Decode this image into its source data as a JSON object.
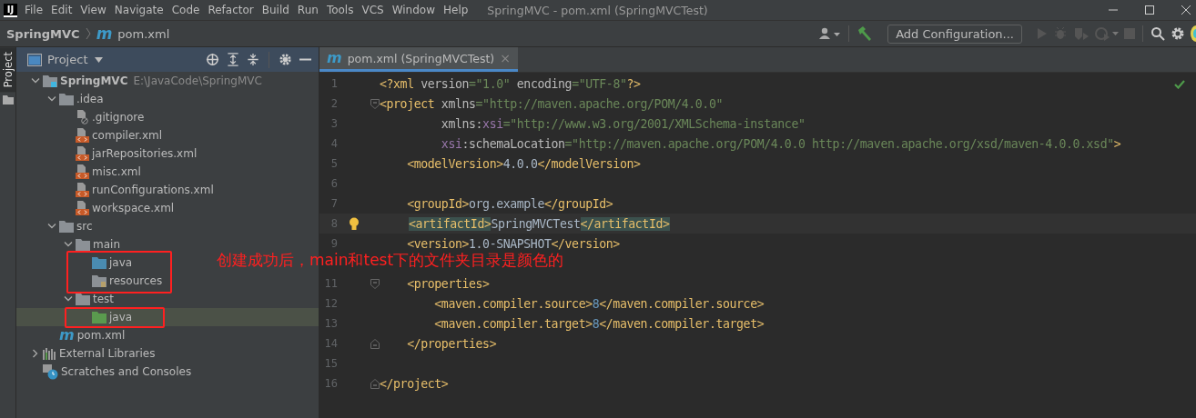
{
  "title_bar": {
    "logo": "IJ",
    "menu": [
      "File",
      "Edit",
      "View",
      "Navigate",
      "Code",
      "Refactor",
      "Build",
      "Run",
      "Tools",
      "VCS",
      "Window",
      "Help"
    ],
    "title": "SpringMVC - pom.xml (SpringMVCTest)"
  },
  "nav_bar": {
    "breadcrumbs": [
      {
        "label": "SpringMVC"
      },
      {
        "icon": "m",
        "label": "pom.xml"
      }
    ],
    "run_config": "Add Configuration..."
  },
  "tool_strip": {
    "tab": {
      "label": "Project",
      "selected": true
    }
  },
  "project_panel": {
    "title": "Project",
    "tree": [
      {
        "label": "SpringMVC",
        "path": "E:\\JavaCode\\SpringMVC",
        "kind": "module",
        "expanded": true,
        "selected": false,
        "children": [
          {
            "label": ".idea",
            "kind": "folder",
            "expanded": true,
            "selected": false,
            "children": [
              {
                "label": ".gitignore",
                "kind": "ignore",
                "selected": false
              },
              {
                "label": "compiler.xml",
                "kind": "xml",
                "selected": false
              },
              {
                "label": "jarRepositories.xml",
                "kind": "xml",
                "selected": false
              },
              {
                "label": "misc.xml",
                "kind": "xml",
                "selected": false
              },
              {
                "label": "runConfigurations.xml",
                "kind": "xml",
                "selected": false
              },
              {
                "label": "workspace.xml",
                "kind": "xml",
                "selected": false
              }
            ]
          },
          {
            "label": "src",
            "kind": "folder",
            "expanded": true,
            "selected": false,
            "children": [
              {
                "label": "main",
                "kind": "folder",
                "expanded": true,
                "selected": false,
                "children": [
                  {
                    "label": "java",
                    "kind": "source",
                    "selected": false
                  },
                  {
                    "label": "resources",
                    "kind": "resources",
                    "selected": false
                  }
                ]
              },
              {
                "label": "test",
                "kind": "folder",
                "expanded": true,
                "selected": false,
                "children": [
                  {
                    "label": "java",
                    "kind": "test",
                    "selected": true
                  }
                ]
              }
            ]
          },
          {
            "label": "pom.xml",
            "kind": "maven",
            "icon": "m",
            "selected": false
          }
        ]
      },
      {
        "label": "External Libraries",
        "kind": "libraries",
        "expanded": false,
        "selected": false
      },
      {
        "label": "Scratches and Consoles",
        "kind": "scratches",
        "selected": false
      }
    ]
  },
  "editor": {
    "tab": {
      "icon": "m",
      "label": "pom.xml (SpringMVCTest)",
      "close": "×",
      "selected": true
    },
    "lines": [
      {
        "number": "1",
        "current": false,
        "tokens": [
          {
            "kind": "tag",
            "s": "<?xml "
          },
          {
            "kind": "attr",
            "s": "version"
          },
          {
            "kind": "str",
            "s": "=\"1.0\" "
          },
          {
            "kind": "attr",
            "s": "encoding"
          },
          {
            "kind": "str",
            "s": "=\"UTF-8\""
          },
          {
            "kind": "tag",
            "s": "?>"
          }
        ]
      },
      {
        "number": "2",
        "current": false,
        "fold": {
          "kind": "start"
        },
        "tokens": [
          {
            "kind": "tag",
            "s": "<project "
          },
          {
            "kind": "attr",
            "s": "xmlns"
          },
          {
            "kind": "str",
            "s": "=\"http://maven.apache.org/POM/4.0.0\""
          }
        ]
      },
      {
        "number": "3",
        "current": false,
        "tokens": [
          {
            "kind": "attr",
            "s": "         xmlns:"
          },
          {
            "kind": "ns",
            "s": "xsi"
          },
          {
            "kind": "str",
            "s": "=\"http://www.w3.org/2001/XMLSchema-instance\""
          }
        ]
      },
      {
        "number": "4",
        "current": false,
        "tokens": [
          {
            "kind": "ns",
            "s": "         xsi"
          },
          {
            "kind": "attr",
            "s": ":schemaLocation"
          },
          {
            "kind": "str",
            "s": "=\"http://maven.apache.org/POM/4.0.0 http://maven.apache.org/xsd/maven-4.0.0.xsd\""
          },
          {
            "kind": "tag",
            "s": ">"
          }
        ]
      },
      {
        "number": "5",
        "current": false,
        "tokens": [
          {
            "kind": "tag",
            "s": "    <modelVersion>"
          },
          {
            "kind": "text",
            "s": "4.0.0"
          },
          {
            "kind": "tag",
            "s": "</modelVersion>"
          }
        ]
      },
      {
        "number": "6",
        "current": false
      },
      {
        "number": "7",
        "current": false,
        "tokens": [
          {
            "kind": "tag",
            "s": "    <groupId>"
          },
          {
            "kind": "text",
            "s": "org.example"
          },
          {
            "kind": "tag",
            "s": "</groupId>"
          }
        ]
      },
      {
        "number": "8",
        "current": true,
        "tokens": [
          {
            "kind": "match",
            "s": "<artifactId>"
          },
          {
            "kind": "text",
            "s": "SpringMVCTest"
          },
          {
            "kind": "match",
            "s": "</artifactId>"
          }
        ]
      },
      {
        "number": "9",
        "current": false,
        "tokens": [
          {
            "kind": "tag",
            "s": "    <version>"
          },
          {
            "kind": "text",
            "s": "1.0-SNAPSHOT"
          },
          {
            "kind": "tag",
            "s": "</version>"
          }
        ]
      },
      {
        "current": false
      },
      {
        "number": "11",
        "current": false,
        "fold": {
          "kind": "start"
        },
        "tokens": [
          {
            "kind": "tag",
            "s": "    <properties>"
          }
        ]
      },
      {
        "number": "12",
        "current": false,
        "tokens": [
          {
            "kind": "tag",
            "s": "        <maven.compiler.source>"
          },
          {
            "kind": "num",
            "s": "8"
          },
          {
            "kind": "tag",
            "s": "</maven.compiler.source>"
          }
        ]
      },
      {
        "number": "13",
        "current": false,
        "tokens": [
          {
            "kind": "tag",
            "s": "        <maven.compiler.target>"
          },
          {
            "kind": "num",
            "s": "8"
          },
          {
            "kind": "tag",
            "s": "</maven.compiler.target>"
          }
        ]
      },
      {
        "number": "14",
        "current": false,
        "fold": {
          "kind": "end"
        },
        "tokens": [
          {
            "kind": "tag",
            "s": "    </properties>"
          }
        ]
      },
      {
        "number": "15",
        "current": false
      },
      {
        "number": "16",
        "current": false,
        "fold": {
          "kind": "end"
        },
        "tokens": [
          {
            "kind": "tag",
            "s": "</project>"
          }
        ]
      }
    ]
  },
  "annotation": {
    "note": "创建成功后，main和test下的文件夹目录是颜色的"
  }
}
